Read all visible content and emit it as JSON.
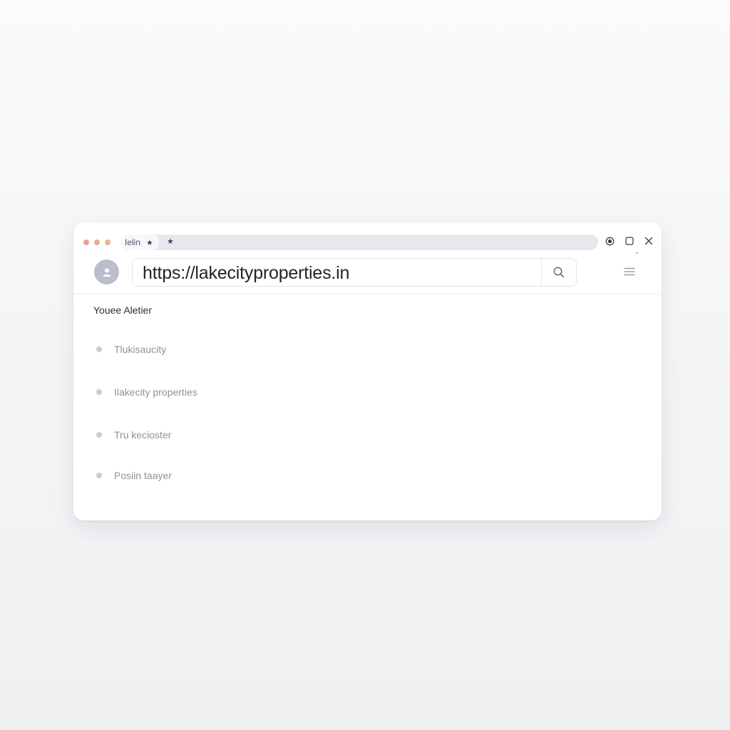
{
  "tab": {
    "label": "Ielin",
    "star_icon": "star-icon",
    "bookmark_icon": "star-icon"
  },
  "window_controls": {
    "traffic_colors": [
      "#e8a58c",
      "#e8a58c",
      "#e8b08c"
    ],
    "record_icon": "record-icon",
    "maximize_icon": "square-icon",
    "close_icon": "close-icon"
  },
  "address_bar": {
    "url": "https://lakecityproperties.in",
    "search_icon": "search-icon",
    "menu_icon": "hamburger-icon",
    "avatar_icon": "user-icon"
  },
  "content": {
    "title": "Youee Aletier",
    "items": [
      {
        "label": "Tlukisaucity"
      },
      {
        "label": "Ilakecity properties"
      },
      {
        "label": "Tru kecioster"
      },
      {
        "label": "Posiin taayer"
      }
    ]
  }
}
